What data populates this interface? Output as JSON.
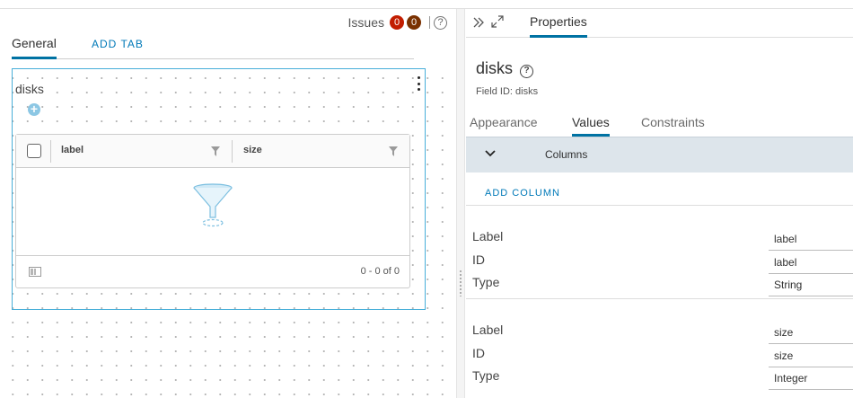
{
  "issues": {
    "label": "Issues",
    "errors": "0",
    "warnings": "0",
    "help": "?"
  },
  "form_tabs": {
    "general": "General",
    "add_tab": "ADD TAB"
  },
  "field": {
    "label": "disks",
    "grid": {
      "columns": [
        {
          "title": "label"
        },
        {
          "title": "size"
        }
      ],
      "pager": "0 - 0 of 0"
    }
  },
  "properties": {
    "tab": "Properties",
    "title": "disks",
    "help": "?",
    "field_id": "Field ID: disks",
    "subtabs": [
      "Appearance",
      "Values",
      "Constraints"
    ],
    "active_subtab": "Values",
    "section_title": "Columns",
    "add_column": "ADD COLUMN",
    "columns": [
      {
        "label_key": "Label",
        "label": "label",
        "id_key": "ID",
        "id": "label",
        "type_key": "Type",
        "type": "String"
      },
      {
        "label_key": "Label",
        "label": "size",
        "id_key": "ID",
        "id": "size",
        "type_key": "Type",
        "type": "Integer"
      }
    ]
  },
  "colors": {
    "accent": "#0072a3",
    "link": "#0079b8",
    "selection_border": "#49afd9",
    "error_badge": "#c21d00",
    "warning_badge": "#7a3100"
  }
}
